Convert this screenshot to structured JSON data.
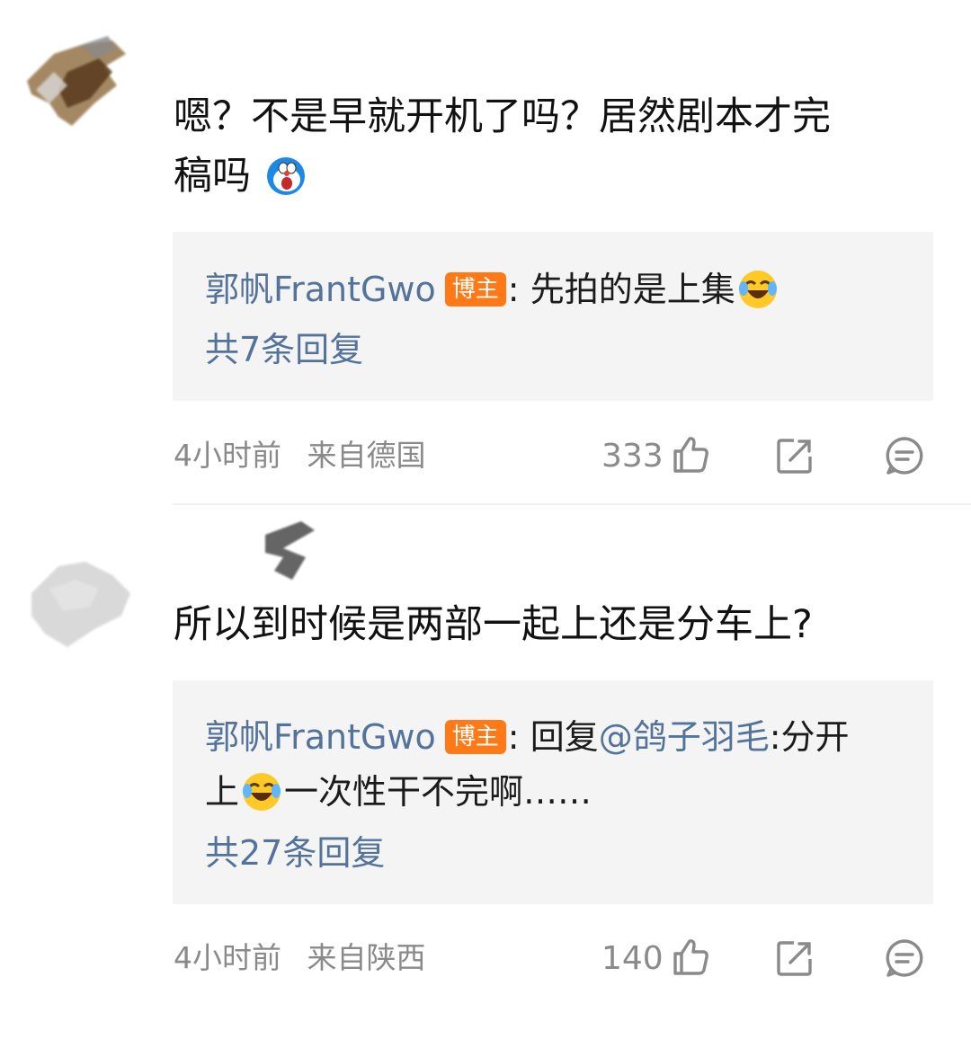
{
  "comments": [
    {
      "text_line1": "嗯？不是早就开机了吗？居然剧本才完",
      "text_line2": "稿吗",
      "emoji": "doraemon-shocked-emoji",
      "reply": {
        "author": "郭帆FrantGwo",
        "badge": "博主",
        "separator": ":",
        "text": "先拍的是上集",
        "emoji": "laugh-cry-emoji",
        "count_label": "共7条回复"
      },
      "time": "4小时前",
      "location": "来自德国",
      "likes": "333"
    },
    {
      "text": "所以到时候是两部一起上还是分车上?",
      "reply": {
        "author": "郭帆FrantGwo",
        "badge": "博主",
        "separator": ":",
        "prefix": "回复",
        "mention": "@鸽子羽毛",
        "text_after_mention": ":分开",
        "line2_start": "上",
        "emoji": "laugh-cry-emoji",
        "line2_end": "一次性干不完啊……",
        "count_label": "共27条回复"
      },
      "time": "4小时前",
      "location": "来自陕西",
      "likes": "140"
    }
  ],
  "colors": {
    "link": "#53739a",
    "badge": "#ff7a17",
    "meta": "#8a8a8a",
    "reply_bg": "#f4f4f4"
  }
}
